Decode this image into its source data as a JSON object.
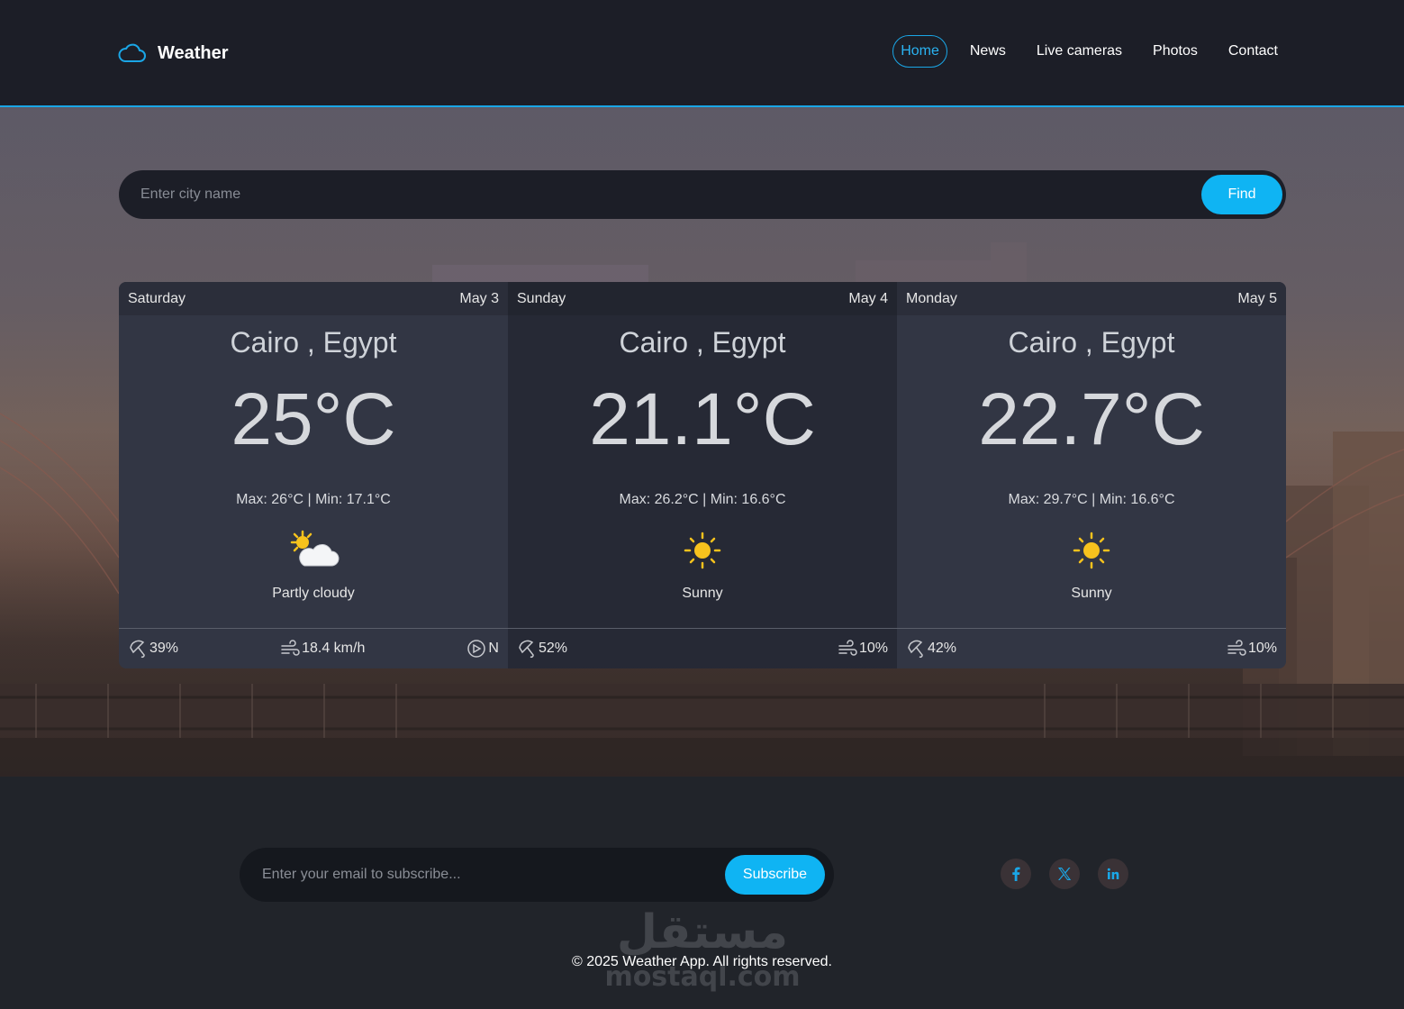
{
  "brand": {
    "name": "Weather",
    "icon": "cloud-icon",
    "accent": "#1aa6e6"
  },
  "nav": [
    {
      "label": "Home",
      "active": true
    },
    {
      "label": "News"
    },
    {
      "label": "Live cameras"
    },
    {
      "label": "Photos"
    },
    {
      "label": "Contact"
    }
  ],
  "search": {
    "placeholder": "Enter city name",
    "value": "",
    "button": "Find"
  },
  "forecast": [
    {
      "day": "Saturday",
      "date": "May 3",
      "location": "Cairo , Egypt",
      "temp": "25°C",
      "minmax": "Max: 26°C | Min: 17.1°C",
      "icon": "partly-cloudy-icon",
      "condition": "Partly cloudy",
      "rain": "39%",
      "wind": "18.4 km/h",
      "direction": "N"
    },
    {
      "day": "Sunday",
      "date": "May 4",
      "location": "Cairo , Egypt",
      "temp": "21.1°C",
      "minmax": "Max: 26.2°C | Min: 16.6°C",
      "icon": "sun-icon",
      "condition": "Sunny",
      "rain": "52%",
      "wind": "10%"
    },
    {
      "day": "Monday",
      "date": "May 5",
      "location": "Cairo , Egypt",
      "temp": "22.7°C",
      "minmax": "Max: 29.7°C | Min: 16.6°C",
      "icon": "sun-icon",
      "condition": "Sunny",
      "rain": "42%",
      "wind": "10%"
    }
  ],
  "footer": {
    "email_placeholder": "Enter your email to subscribe...",
    "subscribe_button": "Subscribe",
    "socials": [
      "facebook-icon",
      "x-icon",
      "linkedin-icon"
    ],
    "copyright": "© 2025 Weather App. All rights reserved.",
    "watermark": "mostaql.com"
  },
  "colors": {
    "primary": "#0fb4f3",
    "header_bg": "#1c1e27",
    "footer_bg": "#21242a"
  }
}
